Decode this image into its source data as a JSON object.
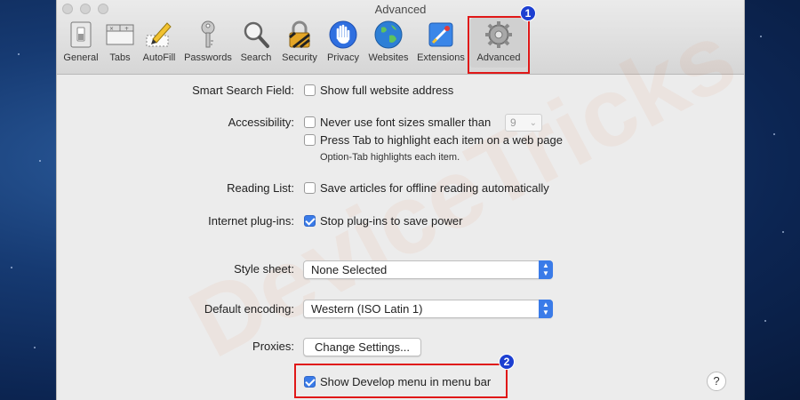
{
  "window": {
    "title": "Advanced"
  },
  "toolbar": {
    "items": [
      {
        "label": "General",
        "icon": "switch-icon"
      },
      {
        "label": "Tabs",
        "icon": "tabs-icon"
      },
      {
        "label": "AutoFill",
        "icon": "pencil-icon"
      },
      {
        "label": "Passwords",
        "icon": "key-icon"
      },
      {
        "label": "Search",
        "icon": "magnifier-icon"
      },
      {
        "label": "Security",
        "icon": "lock-icon"
      },
      {
        "label": "Privacy",
        "icon": "hand-icon"
      },
      {
        "label": "Websites",
        "icon": "globe-icon"
      },
      {
        "label": "Extensions",
        "icon": "puzzle-icon"
      },
      {
        "label": "Advanced",
        "icon": "gear-icon",
        "active": true
      }
    ]
  },
  "annotations": {
    "badge1": "1",
    "badge2": "2",
    "highlight_color": "#e01818",
    "badge_color": "#1c3fd1"
  },
  "settings": {
    "smart_search": {
      "label": "Smart Search Field:",
      "option": "Show full website address",
      "checked": false
    },
    "accessibility": {
      "label": "Accessibility:",
      "font_option": "Never use font sizes smaller than",
      "font_size": "9",
      "font_checked": false,
      "tab_option": "Press Tab to highlight each item on a web page",
      "tab_checked": false,
      "tab_note": "Option-Tab highlights each item."
    },
    "reading_list": {
      "label": "Reading List:",
      "option": "Save articles for offline reading automatically",
      "checked": false
    },
    "plugins": {
      "label": "Internet plug-ins:",
      "option": "Stop plug-ins to save power",
      "checked": true
    },
    "style_sheet": {
      "label": "Style sheet:",
      "value": "None Selected"
    },
    "encoding": {
      "label": "Default encoding:",
      "value": "Western (ISO Latin 1)"
    },
    "proxies": {
      "label": "Proxies:",
      "button": "Change Settings..."
    },
    "develop": {
      "option": "Show Develop menu in menu bar",
      "checked": true
    }
  },
  "help": {
    "label": "?"
  },
  "accent_color": "#3a7be8"
}
